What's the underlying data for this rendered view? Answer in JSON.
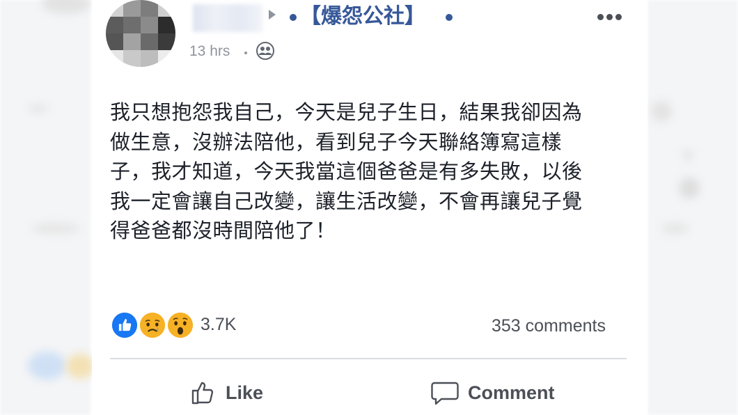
{
  "post": {
    "group_name": "【爆怨公社】",
    "timestamp": "13 hrs",
    "privacy_icon": "friends-icon",
    "text_lines": [
      "我只想抱怨我自己，今天是兒子生日，結果我卻因為",
      "做生意，沒辦法陪他，看到兒子今天聯絡簿寫這樣",
      "子，我才知道，今天我當這個爸爸是有多失敗，以後",
      "我一定會讓自己改變，讓生活改變，不會再讓兒子覺",
      "得爸爸都沒時間陪他了！"
    ]
  },
  "reactions": {
    "icons": [
      "like-reaction-icon",
      "sad-reaction-icon",
      "wow-reaction-icon"
    ],
    "count": "3.7K"
  },
  "comments": {
    "count_label": "353 comments"
  },
  "actions": {
    "like_label": "Like",
    "comment_label": "Comment"
  },
  "colors": {
    "link_blue": "#365899",
    "text": "#1d2129",
    "secondary": "#90949c",
    "like_blue": "#1877f2",
    "emoji_yellow": "#f7b125"
  }
}
